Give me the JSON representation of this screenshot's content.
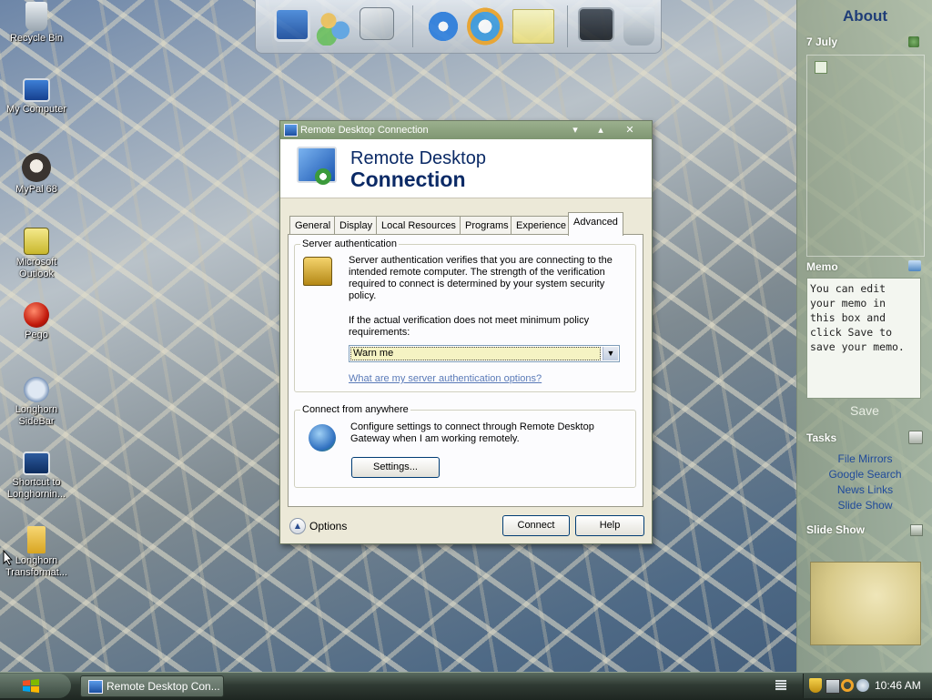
{
  "desktop": {
    "icons": [
      {
        "label": "Recycle Bin",
        "icon": "recycle-bin-icon"
      },
      {
        "label": "My Computer",
        "icon": "computer-icon"
      },
      {
        "label": "MyPal 68",
        "icon": "raccoon-icon"
      },
      {
        "label": "Microsoft Outlook",
        "icon": "outlook-icon"
      },
      {
        "label": "Pego",
        "icon": "red-orb-icon"
      },
      {
        "label": "Longhorn SideBar",
        "icon": "sidebar-icon"
      },
      {
        "label": "Shortcut to Longhornin...",
        "icon": "shortcut-monitor-icon"
      },
      {
        "label": "Longhorn Transformat...",
        "icon": "folder-icon"
      }
    ]
  },
  "dock": {
    "items": [
      "computer-icon",
      "users-icon",
      "scanner-icon",
      "internet-explorer-icon",
      "media-player-icon",
      "sticky-note-icon",
      "settings-icon",
      "recycle-bin-icon"
    ]
  },
  "sidebar": {
    "title": "About",
    "date": "7 July",
    "memo": {
      "header": "Memo",
      "text": "You can edit your memo in this box and click Save to save your memo.",
      "save_label": "Save"
    },
    "tasks": {
      "header": "Tasks",
      "links": [
        "File Mirrors",
        "Google Search",
        "News Links",
        "Slide Show"
      ]
    },
    "slideshow": {
      "header": "Slide Show"
    }
  },
  "dialog": {
    "title": "Remote Desktop Connection",
    "banner": {
      "line1": "Remote Desktop",
      "line2": "Connection"
    },
    "tabs": [
      "General",
      "Display",
      "Local Resources",
      "Programs",
      "Experience",
      "Advanced"
    ],
    "active_tab": "Advanced",
    "server_auth": {
      "legend": "Server authentication",
      "description": "Server authentication verifies that you are connecting to the intended remote computer. The strength of the verification required to connect is determined by your system security policy.",
      "prompt": "If the actual verification does not meet minimum policy requirements:",
      "select_value": "Warn me",
      "link": "What are my server authentication options?"
    },
    "connect_anywhere": {
      "legend": "Connect from anywhere",
      "description": "Configure settings to connect through Remote Desktop Gateway when I am working remotely.",
      "settings_label": "Settings..."
    },
    "options_label": "Options",
    "connect_label": "Connect",
    "help_label": "Help"
  },
  "taskbar": {
    "task_label": "Remote Desktop Con...",
    "clock": "10:46 AM"
  }
}
